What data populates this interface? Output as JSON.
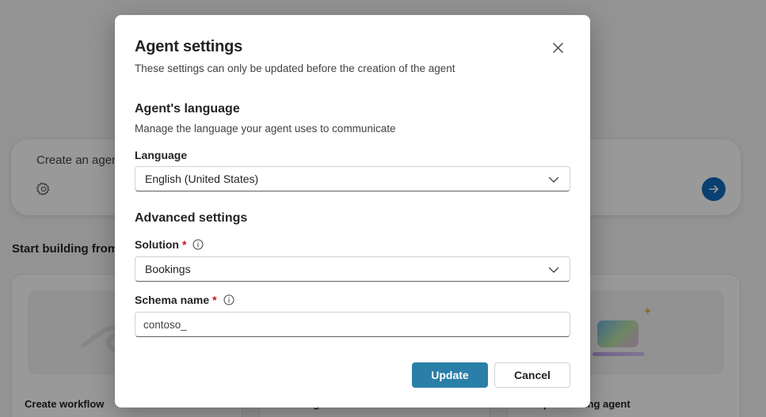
{
  "background": {
    "create_placeholder": "Create an agent",
    "section_title": "Start building from",
    "tiles": [
      {
        "label": "Create workflow"
      },
      {
        "label": "Create agent"
      },
      {
        "label": "Computer-using agent"
      }
    ]
  },
  "dialog": {
    "title": "Agent settings",
    "subtitle": "These settings can only be updated before the creation of the agent",
    "language_section": {
      "heading": "Agent's language",
      "description": "Manage the language your agent uses to communicate",
      "field_label": "Language",
      "value": "English (United States)"
    },
    "advanced_section": {
      "heading": "Advanced settings",
      "solution_label": "Solution",
      "solution_value": "Bookings",
      "schema_label": "Schema name",
      "schema_value": "contoso_",
      "required_mark": "*"
    },
    "buttons": {
      "update": "Update",
      "cancel": "Cancel"
    }
  },
  "colors": {
    "primary_button": "#2a7fa9",
    "required": "#c50f1f",
    "send_button": "#0f6cbd"
  },
  "icons": [
    "close-icon",
    "chevron-down-icon",
    "info-icon",
    "gear-icon",
    "arrow-right-icon"
  ]
}
